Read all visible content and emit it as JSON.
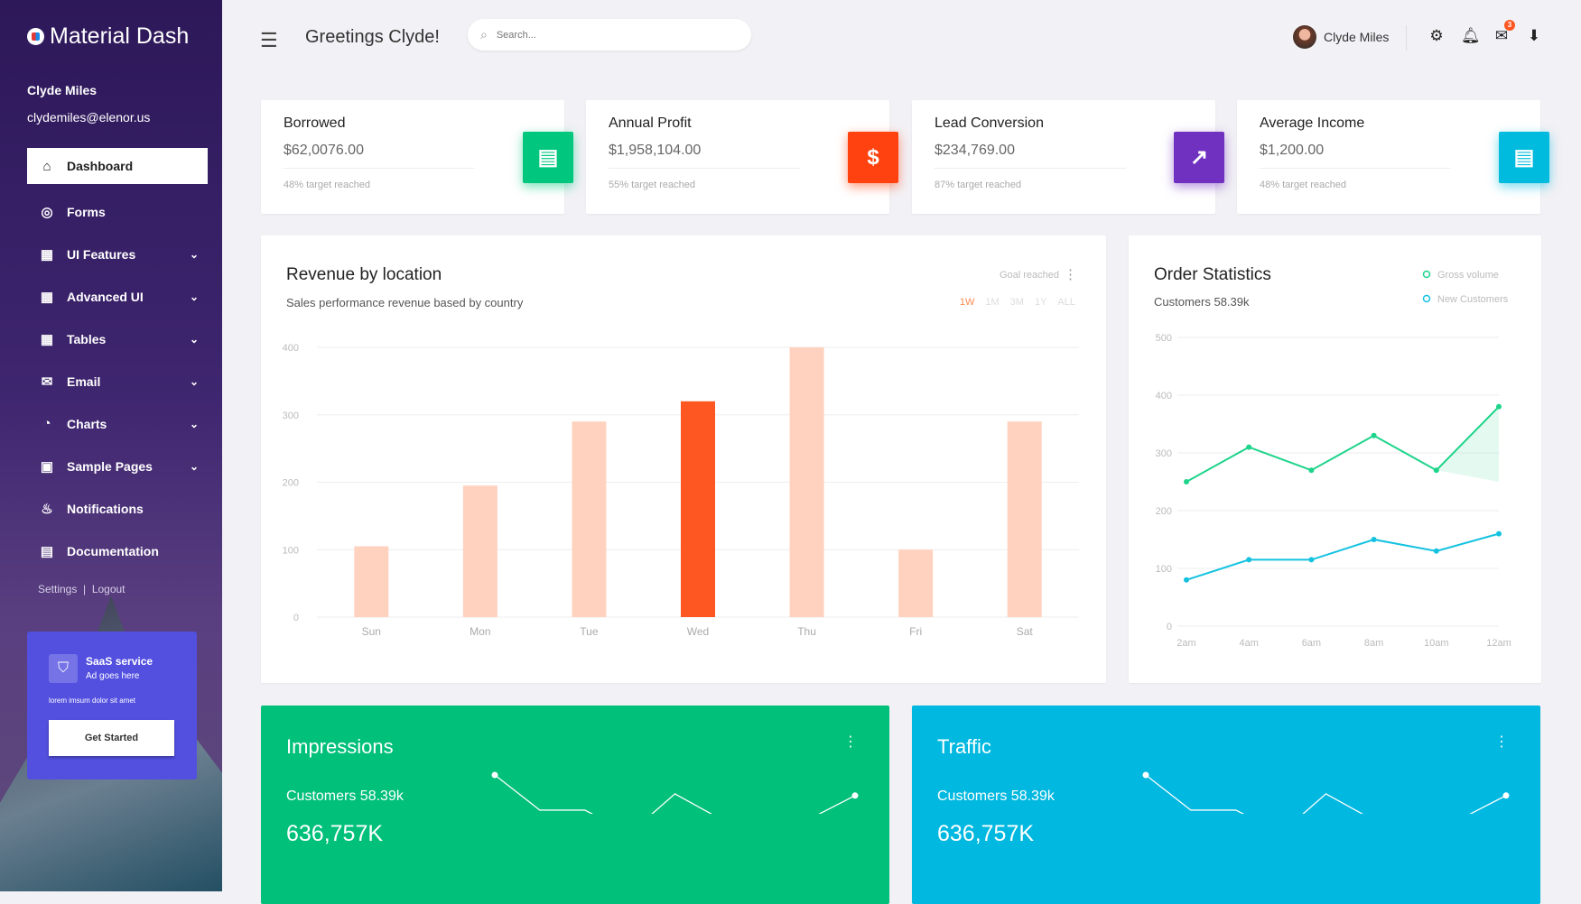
{
  "app": {
    "name": "Material Dash"
  },
  "sidebar": {
    "user_name": "Clyde Miles",
    "user_email": "clydemiles@elenor.us",
    "items": [
      {
        "label": "Dashboard",
        "icon": "home-icon",
        "active": true
      },
      {
        "label": "Forms",
        "icon": "forms-icon"
      },
      {
        "label": "UI Features",
        "icon": "dashboard-icon",
        "expandable": true
      },
      {
        "label": "Advanced UI",
        "icon": "dashboard-icon",
        "expandable": true
      },
      {
        "label": "Tables",
        "icon": "grid-icon",
        "expandable": true
      },
      {
        "label": "Email",
        "icon": "mail-icon",
        "expandable": true
      },
      {
        "label": "Charts",
        "icon": "pie-chart-icon",
        "expandable": true
      },
      {
        "label": "Sample Pages",
        "icon": "pages-icon",
        "expandable": true
      },
      {
        "label": "Notifications",
        "icon": "bell-icon"
      },
      {
        "label": "Documentation",
        "icon": "document-icon"
      }
    ],
    "settings": "Settings",
    "logout": "Logout",
    "ad": {
      "title": "SaaS service",
      "subtitle": "Ad goes here",
      "text": "lorem imsum dolor sit amet",
      "button": "Get Started",
      "color": "#5350e0"
    }
  },
  "header": {
    "greeting": "Greetings Clyde!",
    "search_placeholder": "Search...",
    "user_name": "Clyde Miles",
    "mail_badge": "3"
  },
  "stats": [
    {
      "label": "Borrowed",
      "value": "$62,0076.00",
      "sub": "48% target reached",
      "icon": "list-icon",
      "color": "#00c67e"
    },
    {
      "label": "Annual Profit",
      "value": "$1,958,104.00",
      "sub": "55% target reached",
      "icon": "dollar-icon",
      "color": "#ff420f"
    },
    {
      "label": "Lead Conversion",
      "value": "$234,769.00",
      "sub": "87% target reached",
      "icon": "trending-up-icon",
      "color": "#7030c0"
    },
    {
      "label": "Average Income",
      "value": "$1,200.00",
      "sub": "48% target reached",
      "icon": "card-icon",
      "color": "#00bbdd"
    }
  ],
  "revenue": {
    "title": "Revenue by location",
    "subtitle": "Sales performance revenue based by country",
    "goal": "Goal reached",
    "ranges": [
      "1W",
      "1M",
      "3M",
      "1Y",
      "ALL"
    ],
    "active_range": "1W"
  },
  "orders": {
    "title": "Order Statistics",
    "subtitle": "Customers 58.39k"
  },
  "chart_data": [
    {
      "type": "bar",
      "categories": [
        "Sun",
        "Mon",
        "Tue",
        "Wed",
        "Thu",
        "Fri",
        "Sat"
      ],
      "values": [
        105,
        195,
        290,
        320,
        400,
        100,
        290
      ],
      "highlight": "Wed",
      "ylim": [
        0,
        400
      ],
      "yticks": [
        0,
        100,
        200,
        300,
        400
      ],
      "colors": {
        "bar": "#ffd2bf",
        "highlight": "#ff5722"
      },
      "grid": true
    },
    {
      "type": "line",
      "x": [
        "2am",
        "4am",
        "6am",
        "8am",
        "10am",
        "12am"
      ],
      "ylim": [
        0,
        500
      ],
      "yticks": [
        0,
        100,
        200,
        300,
        400,
        500
      ],
      "legend": "top-right",
      "grid": true,
      "series": [
        {
          "name": "Gross volume",
          "values": [
            250,
            310,
            270,
            330,
            270,
            380
          ],
          "color": "#1dd48a"
        },
        {
          "name": "New Customers",
          "values": [
            80,
            115,
            115,
            150,
            130,
            160
          ],
          "color": "#14c2e0"
        }
      ]
    },
    {
      "type": "line",
      "values": [
        81,
        40,
        40,
        13,
        59,
        30,
        18,
        30,
        57
      ],
      "color": "#ffffff"
    },
    {
      "type": "line",
      "values": [
        81,
        40,
        40,
        13,
        59,
        30,
        18,
        30,
        57
      ],
      "color": "#ffffff"
    }
  ],
  "bottom": [
    {
      "title": "Impressions",
      "customers": "Customers 58.39k",
      "value": "636,757K",
      "color": "#00c07a"
    },
    {
      "title": "Traffic",
      "customers": "Customers 58.39k",
      "value": "636,757K",
      "color": "#00b8e0"
    }
  ]
}
